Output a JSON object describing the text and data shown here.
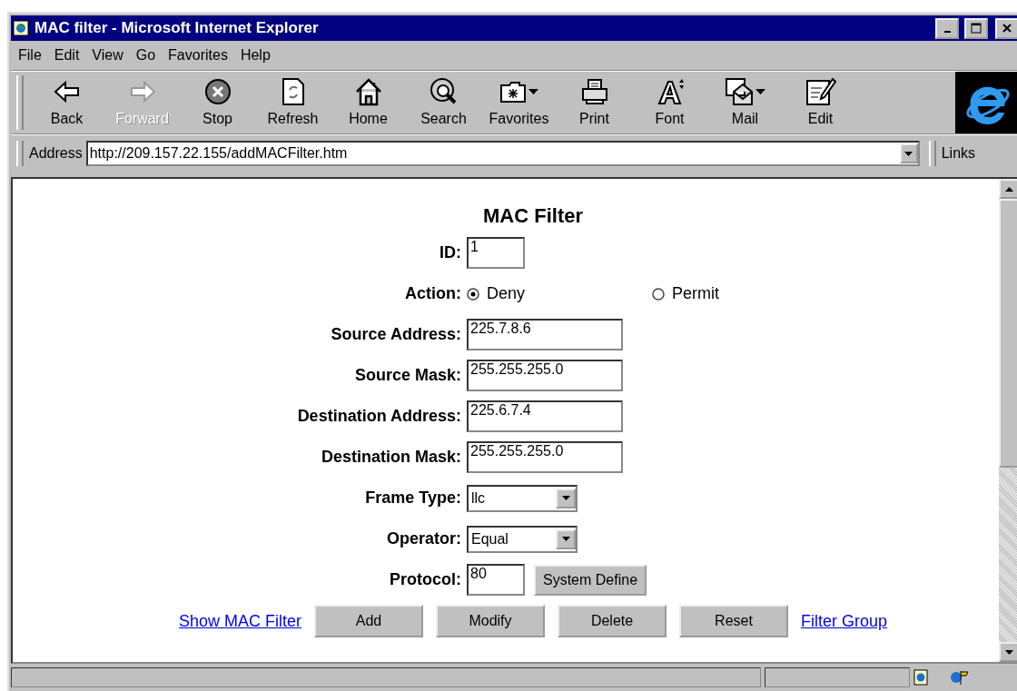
{
  "window": {
    "title": "MAC filter - Microsoft Internet Explorer"
  },
  "menu": [
    "File",
    "Edit",
    "View",
    "Go",
    "Favorites",
    "Help"
  ],
  "toolbar": [
    {
      "label": "Back",
      "disabled": false,
      "dropdown": false
    },
    {
      "label": "Forward",
      "disabled": true,
      "dropdown": false
    },
    {
      "label": "Stop",
      "disabled": false,
      "dropdown": false
    },
    {
      "label": "Refresh",
      "disabled": false,
      "dropdown": false
    },
    {
      "label": "Home",
      "disabled": false,
      "dropdown": false
    },
    {
      "label": "Search",
      "disabled": false,
      "dropdown": false
    },
    {
      "label": "Favorites",
      "disabled": false,
      "dropdown": true
    },
    {
      "label": "Print",
      "disabled": false,
      "dropdown": false
    },
    {
      "label": "Font",
      "disabled": false,
      "dropdown": false
    },
    {
      "label": "Mail",
      "disabled": false,
      "dropdown": true
    },
    {
      "label": "Edit",
      "disabled": false,
      "dropdown": false
    }
  ],
  "address": {
    "label": "Address",
    "value": "http://209.157.22.155/addMACFilter.htm",
    "links": "Links"
  },
  "form": {
    "title": "MAC Filter",
    "rows": [
      {
        "kind": "short",
        "label": "ID:",
        "value": "1"
      },
      {
        "kind": "radio",
        "label": "Action:",
        "options": [
          {
            "label": "Deny",
            "selected": true
          },
          {
            "label": "Permit",
            "selected": false
          }
        ]
      },
      {
        "kind": "text",
        "label": "Source Address:",
        "value": "225.7.8.6"
      },
      {
        "kind": "text",
        "label": "Source Mask:",
        "value": "255.255.255.0"
      },
      {
        "kind": "text",
        "label": "Destination Address:",
        "value": "225.6.7.4"
      },
      {
        "kind": "text",
        "label": "Destination Mask:",
        "value": "255.255.255.0"
      },
      {
        "kind": "select",
        "label": "Frame Type:",
        "value": "llc"
      },
      {
        "kind": "select",
        "label": "Operator:",
        "value": "Equal"
      },
      {
        "kind": "short_button",
        "label": "Protocol:",
        "value": "80",
        "button": "System Define"
      }
    ],
    "actions": [
      {
        "kind": "link",
        "label": "Show MAC Filter"
      },
      {
        "kind": "button",
        "label": "Add"
      },
      {
        "kind": "button",
        "label": "Modify"
      },
      {
        "kind": "button",
        "label": "Delete"
      },
      {
        "kind": "button",
        "label": "Reset"
      },
      {
        "kind": "link",
        "label": "Filter Group"
      }
    ]
  }
}
